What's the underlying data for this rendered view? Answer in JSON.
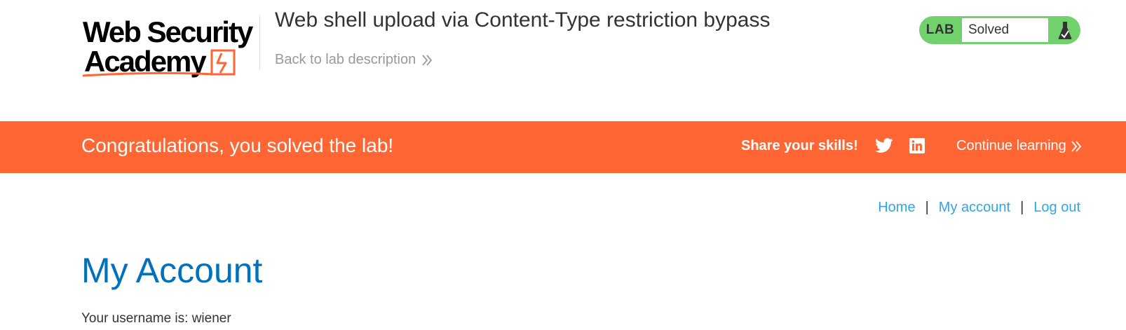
{
  "header": {
    "logo_line1": "Web Security",
    "logo_line2": "Academy",
    "lab_title": "Web shell upload via Content-Type restriction bypass",
    "back_link": "Back to lab description",
    "lab_badge": "LAB",
    "lab_status": "Solved"
  },
  "banner": {
    "message": "Congratulations, you solved the lab!",
    "share_label": "Share your skills!",
    "continue_link": "Continue learning"
  },
  "nav": {
    "home": "Home",
    "separator": "|",
    "my_account": "My account",
    "log_out": "Log out"
  },
  "main": {
    "title": "My Account",
    "username_text": "Your username is: wiener"
  },
  "colors": {
    "brand_orange": "#ff6633",
    "link_blue": "#2fa6e6",
    "title_blue": "#0071bc",
    "solved_green": "#70d16d"
  },
  "icons": {
    "back": "chevron-double-right-icon",
    "flask": "flask-icon",
    "twitter": "twitter-icon",
    "linkedin": "linkedin-icon",
    "continue": "chevron-double-right-icon"
  }
}
